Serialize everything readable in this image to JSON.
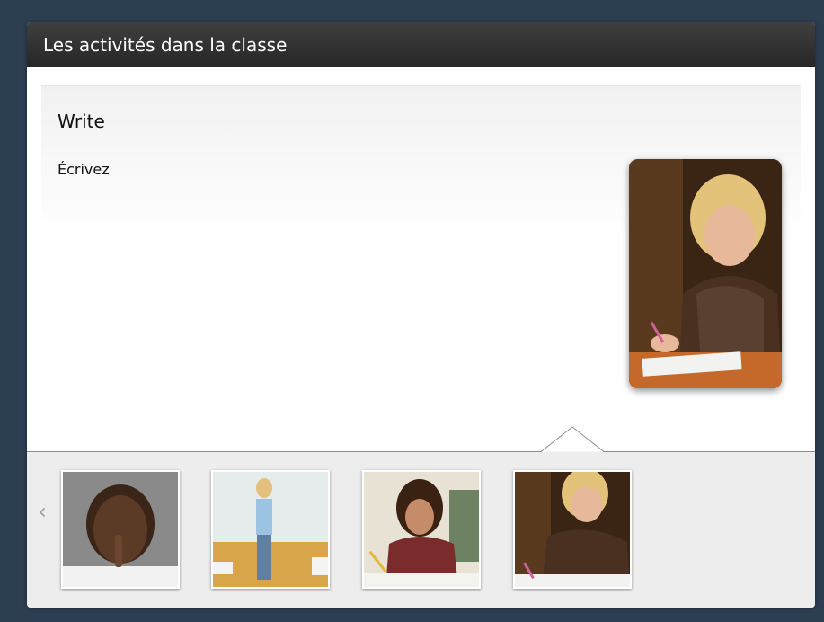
{
  "window": {
    "title": "Les activités dans la classe"
  },
  "card": {
    "title": "Write",
    "subtitle": "Écrivez"
  },
  "thumbnails": [
    {
      "name": "quiet"
    },
    {
      "name": "stand-up"
    },
    {
      "name": "take-notes"
    },
    {
      "name": "write",
      "selected": true
    }
  ],
  "icons": {
    "prev": "chevron-left-icon"
  },
  "colors": {
    "background": "#2c3e52",
    "titlebar": "#2f2f2f",
    "strip": "#ededed"
  }
}
